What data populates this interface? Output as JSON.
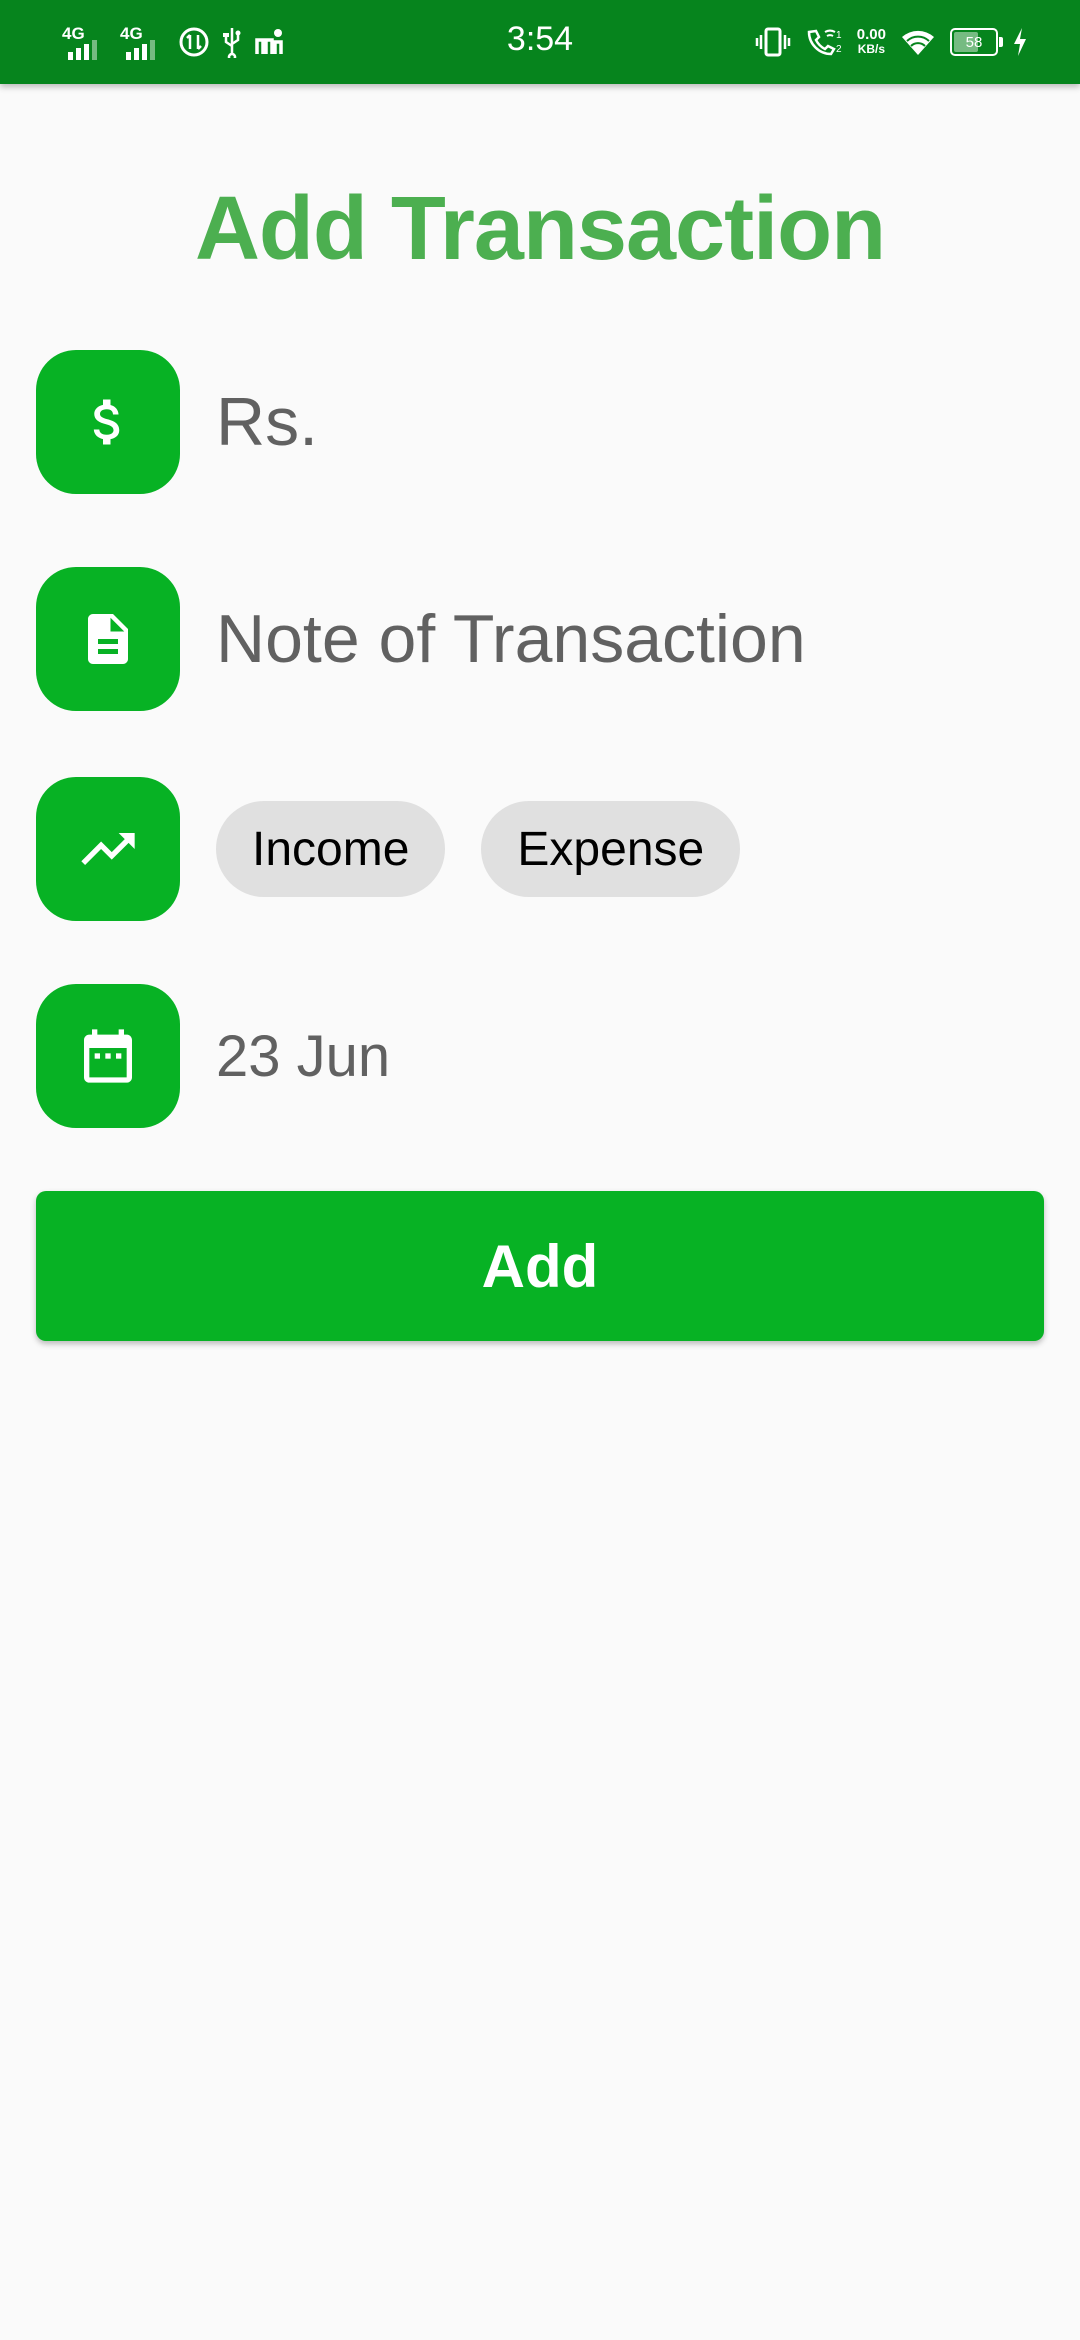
{
  "status_bar": {
    "time": "3:54",
    "network_1": "4G",
    "network_2": "4G",
    "data_speed_value": "0.00",
    "data_speed_unit": "KB/s",
    "battery": "58"
  },
  "page": {
    "title": "Add Transaction"
  },
  "form": {
    "amount_placeholder": "Rs.",
    "note_placeholder": "Note of Transaction",
    "type_options": [
      "Income",
      "Expense"
    ],
    "date_value": "23 Jun"
  },
  "actions": {
    "add_label": "Add"
  },
  "colors": {
    "status_bar": "#06841d",
    "accent": "#07b224",
    "title": "#4caf50"
  }
}
